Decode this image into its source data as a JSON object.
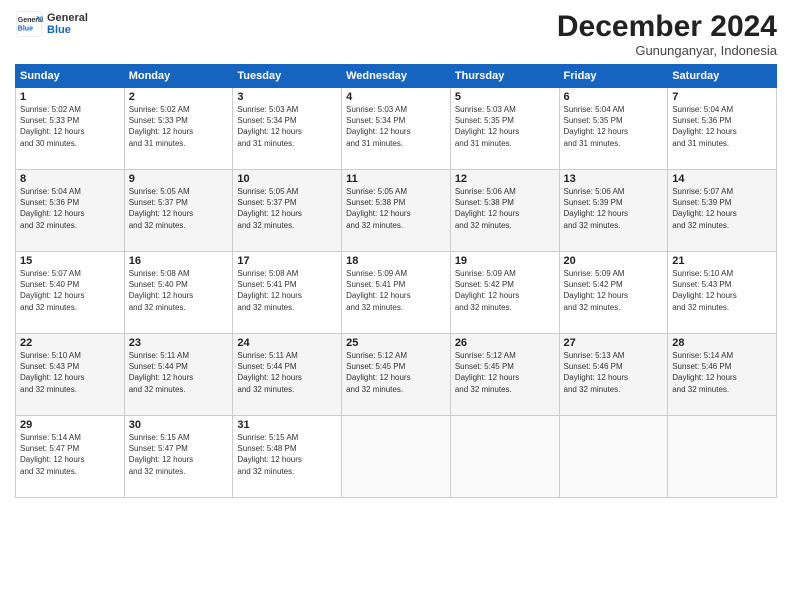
{
  "logo": {
    "line1": "General",
    "line2": "Blue"
  },
  "title": "December 2024",
  "subtitle": "Gununganyar, Indonesia",
  "headers": [
    "Sunday",
    "Monday",
    "Tuesday",
    "Wednesday",
    "Thursday",
    "Friday",
    "Saturday"
  ],
  "weeks": [
    [
      {
        "day": "1",
        "info": "Sunrise: 5:02 AM\nSunset: 5:33 PM\nDaylight: 12 hours\nand 30 minutes."
      },
      {
        "day": "2",
        "info": "Sunrise: 5:02 AM\nSunset: 5:33 PM\nDaylight: 12 hours\nand 31 minutes."
      },
      {
        "day": "3",
        "info": "Sunrise: 5:03 AM\nSunset: 5:34 PM\nDaylight: 12 hours\nand 31 minutes."
      },
      {
        "day": "4",
        "info": "Sunrise: 5:03 AM\nSunset: 5:34 PM\nDaylight: 12 hours\nand 31 minutes."
      },
      {
        "day": "5",
        "info": "Sunrise: 5:03 AM\nSunset: 5:35 PM\nDaylight: 12 hours\nand 31 minutes."
      },
      {
        "day": "6",
        "info": "Sunrise: 5:04 AM\nSunset: 5:35 PM\nDaylight: 12 hours\nand 31 minutes."
      },
      {
        "day": "7",
        "info": "Sunrise: 5:04 AM\nSunset: 5:36 PM\nDaylight: 12 hours\nand 31 minutes."
      }
    ],
    [
      {
        "day": "8",
        "info": "Sunrise: 5:04 AM\nSunset: 5:36 PM\nDaylight: 12 hours\nand 32 minutes."
      },
      {
        "day": "9",
        "info": "Sunrise: 5:05 AM\nSunset: 5:37 PM\nDaylight: 12 hours\nand 32 minutes."
      },
      {
        "day": "10",
        "info": "Sunrise: 5:05 AM\nSunset: 5:37 PM\nDaylight: 12 hours\nand 32 minutes."
      },
      {
        "day": "11",
        "info": "Sunrise: 5:05 AM\nSunset: 5:38 PM\nDaylight: 12 hours\nand 32 minutes."
      },
      {
        "day": "12",
        "info": "Sunrise: 5:06 AM\nSunset: 5:38 PM\nDaylight: 12 hours\nand 32 minutes."
      },
      {
        "day": "13",
        "info": "Sunrise: 5:06 AM\nSunset: 5:39 PM\nDaylight: 12 hours\nand 32 minutes."
      },
      {
        "day": "14",
        "info": "Sunrise: 5:07 AM\nSunset: 5:39 PM\nDaylight: 12 hours\nand 32 minutes."
      }
    ],
    [
      {
        "day": "15",
        "info": "Sunrise: 5:07 AM\nSunset: 5:40 PM\nDaylight: 12 hours\nand 32 minutes."
      },
      {
        "day": "16",
        "info": "Sunrise: 5:08 AM\nSunset: 5:40 PM\nDaylight: 12 hours\nand 32 minutes."
      },
      {
        "day": "17",
        "info": "Sunrise: 5:08 AM\nSunset: 5:41 PM\nDaylight: 12 hours\nand 32 minutes."
      },
      {
        "day": "18",
        "info": "Sunrise: 5:09 AM\nSunset: 5:41 PM\nDaylight: 12 hours\nand 32 minutes."
      },
      {
        "day": "19",
        "info": "Sunrise: 5:09 AM\nSunset: 5:42 PM\nDaylight: 12 hours\nand 32 minutes."
      },
      {
        "day": "20",
        "info": "Sunrise: 5:09 AM\nSunset: 5:42 PM\nDaylight: 12 hours\nand 32 minutes."
      },
      {
        "day": "21",
        "info": "Sunrise: 5:10 AM\nSunset: 5:43 PM\nDaylight: 12 hours\nand 32 minutes."
      }
    ],
    [
      {
        "day": "22",
        "info": "Sunrise: 5:10 AM\nSunset: 5:43 PM\nDaylight: 12 hours\nand 32 minutes."
      },
      {
        "day": "23",
        "info": "Sunrise: 5:11 AM\nSunset: 5:44 PM\nDaylight: 12 hours\nand 32 minutes."
      },
      {
        "day": "24",
        "info": "Sunrise: 5:11 AM\nSunset: 5:44 PM\nDaylight: 12 hours\nand 32 minutes."
      },
      {
        "day": "25",
        "info": "Sunrise: 5:12 AM\nSunset: 5:45 PM\nDaylight: 12 hours\nand 32 minutes."
      },
      {
        "day": "26",
        "info": "Sunrise: 5:12 AM\nSunset: 5:45 PM\nDaylight: 12 hours\nand 32 minutes."
      },
      {
        "day": "27",
        "info": "Sunrise: 5:13 AM\nSunset: 5:46 PM\nDaylight: 12 hours\nand 32 minutes."
      },
      {
        "day": "28",
        "info": "Sunrise: 5:14 AM\nSunset: 5:46 PM\nDaylight: 12 hours\nand 32 minutes."
      }
    ],
    [
      {
        "day": "29",
        "info": "Sunrise: 5:14 AM\nSunset: 5:47 PM\nDaylight: 12 hours\nand 32 minutes."
      },
      {
        "day": "30",
        "info": "Sunrise: 5:15 AM\nSunset: 5:47 PM\nDaylight: 12 hours\nand 32 minutes."
      },
      {
        "day": "31",
        "info": "Sunrise: 5:15 AM\nSunset: 5:48 PM\nDaylight: 12 hours\nand 32 minutes."
      },
      {
        "day": "",
        "info": ""
      },
      {
        "day": "",
        "info": ""
      },
      {
        "day": "",
        "info": ""
      },
      {
        "day": "",
        "info": ""
      }
    ]
  ]
}
